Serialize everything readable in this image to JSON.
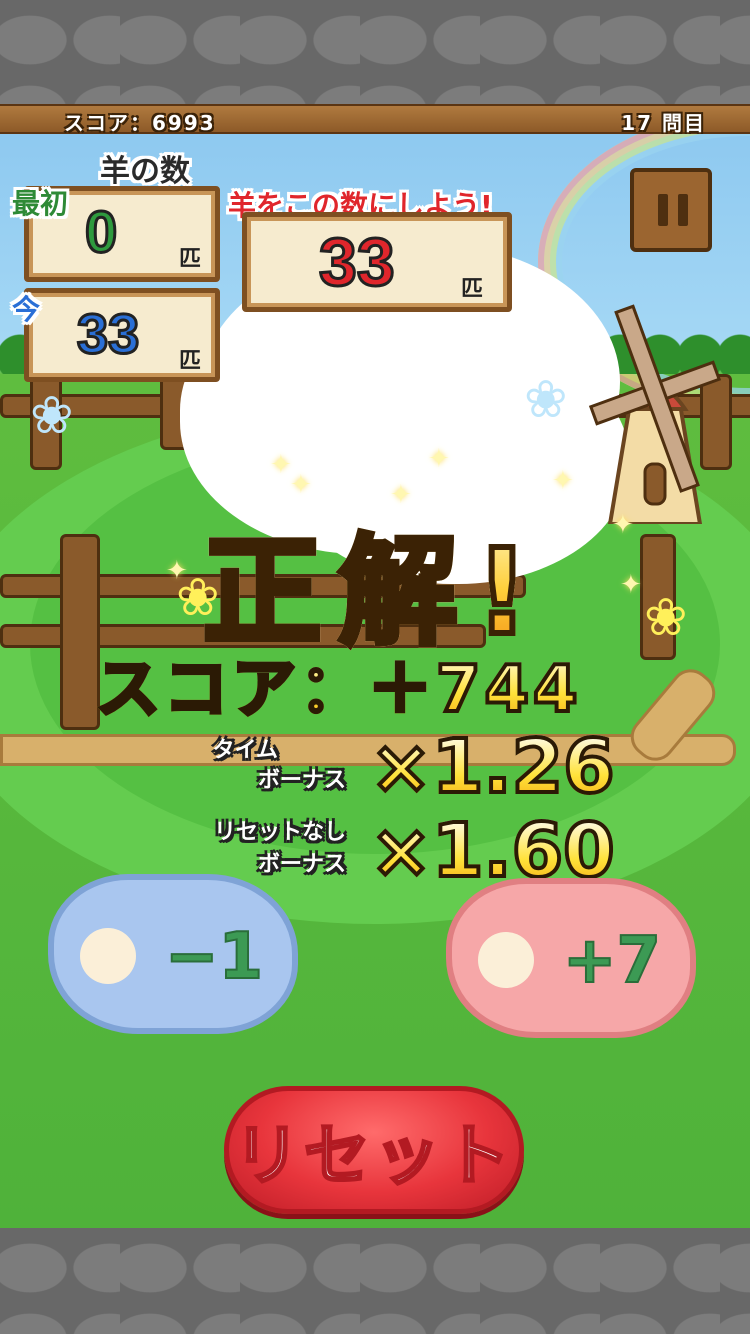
{
  "header": {
    "score_label": "スコア：6993",
    "question_label": "17 問目"
  },
  "sheep_count": {
    "title": "羊の数",
    "initial_label": "最初",
    "initial_value": "0",
    "current_label": "今",
    "current_value": "33",
    "unit": "匹"
  },
  "target": {
    "instruction": "羊をこの数にしよう!",
    "value": "33",
    "unit": "匹"
  },
  "result": {
    "title": "正解!",
    "score_line": "スコア：＋744",
    "time_bonus_label_1": "タイム",
    "time_bonus_label_2": "ボーナス",
    "time_bonus_value": "×1.26",
    "no_reset_label_1": "リセットなし",
    "no_reset_label_2": "ボーナス",
    "no_reset_value": "×1.60"
  },
  "buttons": {
    "minus": "−1",
    "plus": "+7",
    "reset": "リセット"
  },
  "colors": {
    "initial_value": "#2e9a3e",
    "current_value": "#2a6fd6",
    "target_value": "#e0262c",
    "minus_cloud": "#a9c6ef",
    "plus_cloud": "#f6a7a8"
  }
}
